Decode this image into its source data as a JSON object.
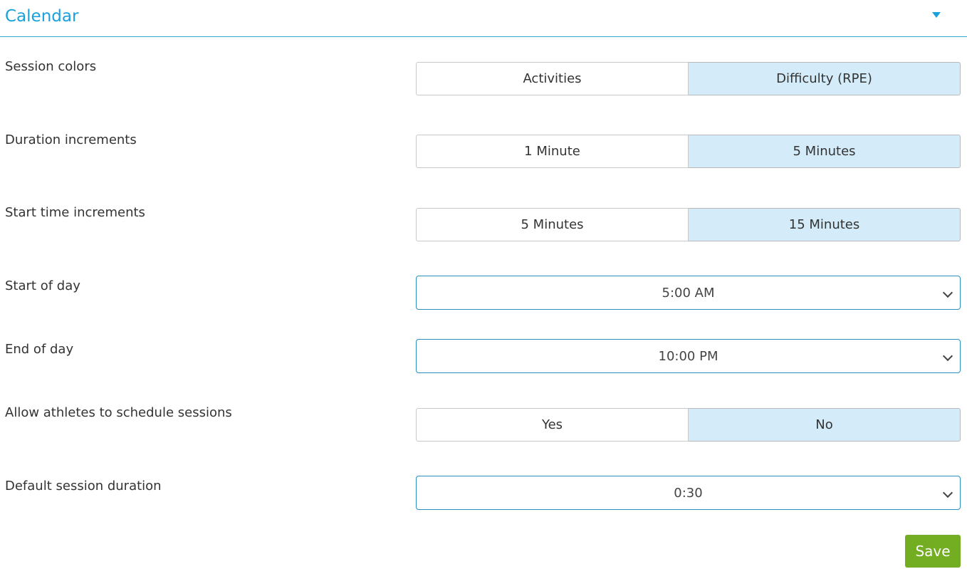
{
  "header": {
    "title": "Calendar",
    "toggle_icon": "caret-down-icon",
    "accent_color": "#1aa1dc"
  },
  "settings": {
    "session_colors": {
      "label": "Session colors",
      "options": [
        "Activities",
        "Difficulty (RPE)"
      ],
      "selected": "Difficulty (RPE)"
    },
    "duration_increments": {
      "label": "Duration increments",
      "options": [
        "1 Minute",
        "5 Minutes"
      ],
      "selected": "5 Minutes"
    },
    "start_time_increments": {
      "label": "Start time increments",
      "options": [
        "5 Minutes",
        "15 Minutes"
      ],
      "selected": "15 Minutes"
    },
    "start_of_day": {
      "label": "Start of day",
      "value": "5:00 AM"
    },
    "end_of_day": {
      "label": "End of day",
      "value": "10:00 PM"
    },
    "allow_athletes_schedule": {
      "label": "Allow athletes to schedule sessions",
      "options": [
        "Yes",
        "No"
      ],
      "selected": "No"
    },
    "default_session_duration": {
      "label": "Default session duration",
      "value": "0:30"
    }
  },
  "actions": {
    "save_label": "Save",
    "save_color": "#72ad22"
  },
  "colors": {
    "selected_segment": "#d4ecf9",
    "select_border": "#2a8fc7"
  }
}
